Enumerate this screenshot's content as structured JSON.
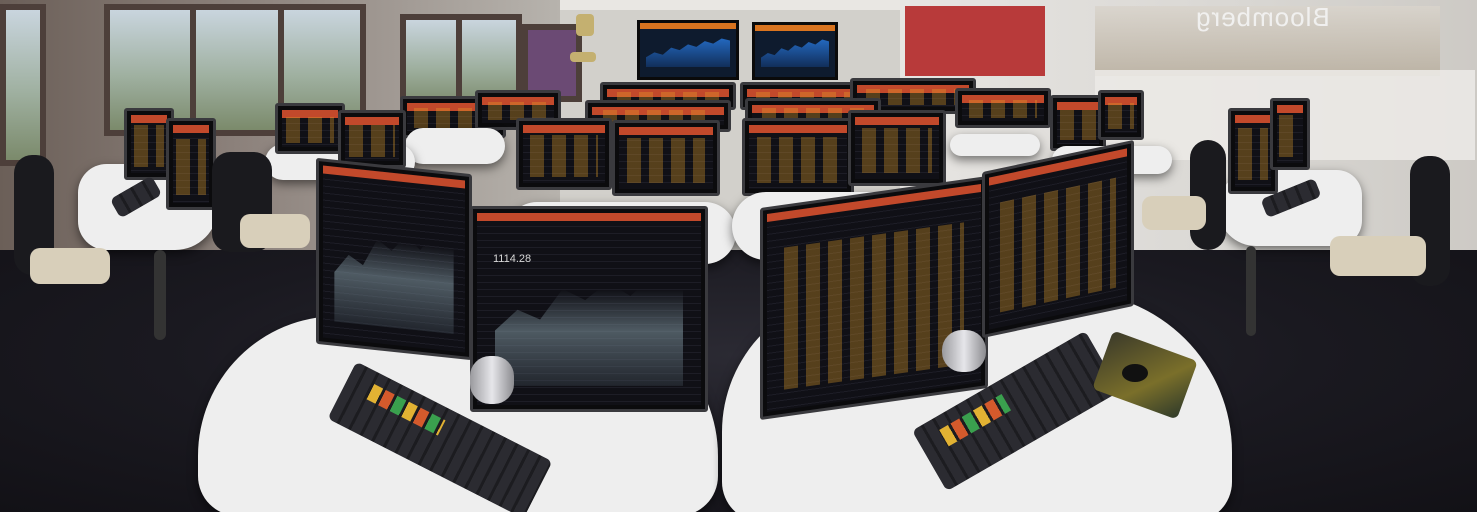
{
  "scene": {
    "description": "",
    "wall_sign_text": "Bloomberg",
    "colors": {
      "desk": "#eeeeee",
      "floor": "#1a1920",
      "terminal_orange": "#d9741f",
      "terminal_red": "#c2492b",
      "chart_blue": "#2878dc"
    }
  },
  "monitors_foreground": [
    {
      "screen_value": "1114.28"
    }
  ]
}
